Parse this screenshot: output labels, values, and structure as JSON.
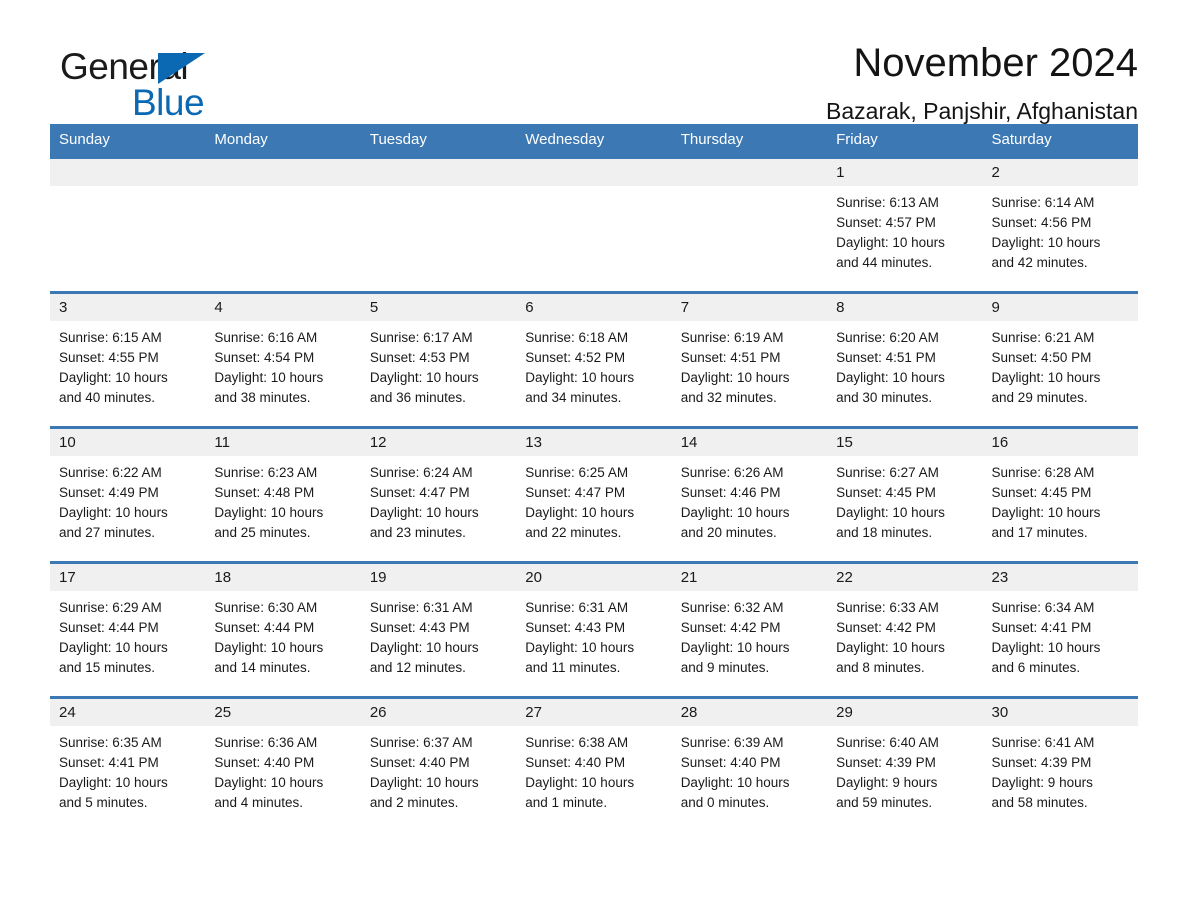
{
  "logo": {
    "word1": "General",
    "word2": "Blue",
    "triangle_color": "#0b69b4"
  },
  "header": {
    "title": "November 2024",
    "subtitle": "Bazarak, Panjshir, Afghanistan"
  },
  "theme": {
    "header_blue": "#3b78b4",
    "daynum_bg": "#f0f0f0",
    "text": "#1a1a1a"
  },
  "calendar": {
    "weekdays": [
      "Sunday",
      "Monday",
      "Tuesday",
      "Wednesday",
      "Thursday",
      "Friday",
      "Saturday"
    ],
    "weeks": [
      [
        {
          "day": "",
          "sunrise": "",
          "sunset": "",
          "daylight_line1": "",
          "daylight_line2": ""
        },
        {
          "day": "",
          "sunrise": "",
          "sunset": "",
          "daylight_line1": "",
          "daylight_line2": ""
        },
        {
          "day": "",
          "sunrise": "",
          "sunset": "",
          "daylight_line1": "",
          "daylight_line2": ""
        },
        {
          "day": "",
          "sunrise": "",
          "sunset": "",
          "daylight_line1": "",
          "daylight_line2": ""
        },
        {
          "day": "",
          "sunrise": "",
          "sunset": "",
          "daylight_line1": "",
          "daylight_line2": ""
        },
        {
          "day": "1",
          "sunrise": "Sunrise: 6:13 AM",
          "sunset": "Sunset: 4:57 PM",
          "daylight_line1": "Daylight: 10 hours",
          "daylight_line2": "and 44 minutes."
        },
        {
          "day": "2",
          "sunrise": "Sunrise: 6:14 AM",
          "sunset": "Sunset: 4:56 PM",
          "daylight_line1": "Daylight: 10 hours",
          "daylight_line2": "and 42 minutes."
        }
      ],
      [
        {
          "day": "3",
          "sunrise": "Sunrise: 6:15 AM",
          "sunset": "Sunset: 4:55 PM",
          "daylight_line1": "Daylight: 10 hours",
          "daylight_line2": "and 40 minutes."
        },
        {
          "day": "4",
          "sunrise": "Sunrise: 6:16 AM",
          "sunset": "Sunset: 4:54 PM",
          "daylight_line1": "Daylight: 10 hours",
          "daylight_line2": "and 38 minutes."
        },
        {
          "day": "5",
          "sunrise": "Sunrise: 6:17 AM",
          "sunset": "Sunset: 4:53 PM",
          "daylight_line1": "Daylight: 10 hours",
          "daylight_line2": "and 36 minutes."
        },
        {
          "day": "6",
          "sunrise": "Sunrise: 6:18 AM",
          "sunset": "Sunset: 4:52 PM",
          "daylight_line1": "Daylight: 10 hours",
          "daylight_line2": "and 34 minutes."
        },
        {
          "day": "7",
          "sunrise": "Sunrise: 6:19 AM",
          "sunset": "Sunset: 4:51 PM",
          "daylight_line1": "Daylight: 10 hours",
          "daylight_line2": "and 32 minutes."
        },
        {
          "day": "8",
          "sunrise": "Sunrise: 6:20 AM",
          "sunset": "Sunset: 4:51 PM",
          "daylight_line1": "Daylight: 10 hours",
          "daylight_line2": "and 30 minutes."
        },
        {
          "day": "9",
          "sunrise": "Sunrise: 6:21 AM",
          "sunset": "Sunset: 4:50 PM",
          "daylight_line1": "Daylight: 10 hours",
          "daylight_line2": "and 29 minutes."
        }
      ],
      [
        {
          "day": "10",
          "sunrise": "Sunrise: 6:22 AM",
          "sunset": "Sunset: 4:49 PM",
          "daylight_line1": "Daylight: 10 hours",
          "daylight_line2": "and 27 minutes."
        },
        {
          "day": "11",
          "sunrise": "Sunrise: 6:23 AM",
          "sunset": "Sunset: 4:48 PM",
          "daylight_line1": "Daylight: 10 hours",
          "daylight_line2": "and 25 minutes."
        },
        {
          "day": "12",
          "sunrise": "Sunrise: 6:24 AM",
          "sunset": "Sunset: 4:47 PM",
          "daylight_line1": "Daylight: 10 hours",
          "daylight_line2": "and 23 minutes."
        },
        {
          "day": "13",
          "sunrise": "Sunrise: 6:25 AM",
          "sunset": "Sunset: 4:47 PM",
          "daylight_line1": "Daylight: 10 hours",
          "daylight_line2": "and 22 minutes."
        },
        {
          "day": "14",
          "sunrise": "Sunrise: 6:26 AM",
          "sunset": "Sunset: 4:46 PM",
          "daylight_line1": "Daylight: 10 hours",
          "daylight_line2": "and 20 minutes."
        },
        {
          "day": "15",
          "sunrise": "Sunrise: 6:27 AM",
          "sunset": "Sunset: 4:45 PM",
          "daylight_line1": "Daylight: 10 hours",
          "daylight_line2": "and 18 minutes."
        },
        {
          "day": "16",
          "sunrise": "Sunrise: 6:28 AM",
          "sunset": "Sunset: 4:45 PM",
          "daylight_line1": "Daylight: 10 hours",
          "daylight_line2": "and 17 minutes."
        }
      ],
      [
        {
          "day": "17",
          "sunrise": "Sunrise: 6:29 AM",
          "sunset": "Sunset: 4:44 PM",
          "daylight_line1": "Daylight: 10 hours",
          "daylight_line2": "and 15 minutes."
        },
        {
          "day": "18",
          "sunrise": "Sunrise: 6:30 AM",
          "sunset": "Sunset: 4:44 PM",
          "daylight_line1": "Daylight: 10 hours",
          "daylight_line2": "and 14 minutes."
        },
        {
          "day": "19",
          "sunrise": "Sunrise: 6:31 AM",
          "sunset": "Sunset: 4:43 PM",
          "daylight_line1": "Daylight: 10 hours",
          "daylight_line2": "and 12 minutes."
        },
        {
          "day": "20",
          "sunrise": "Sunrise: 6:31 AM",
          "sunset": "Sunset: 4:43 PM",
          "daylight_line1": "Daylight: 10 hours",
          "daylight_line2": "and 11 minutes."
        },
        {
          "day": "21",
          "sunrise": "Sunrise: 6:32 AM",
          "sunset": "Sunset: 4:42 PM",
          "daylight_line1": "Daylight: 10 hours",
          "daylight_line2": "and 9 minutes."
        },
        {
          "day": "22",
          "sunrise": "Sunrise: 6:33 AM",
          "sunset": "Sunset: 4:42 PM",
          "daylight_line1": "Daylight: 10 hours",
          "daylight_line2": "and 8 minutes."
        },
        {
          "day": "23",
          "sunrise": "Sunrise: 6:34 AM",
          "sunset": "Sunset: 4:41 PM",
          "daylight_line1": "Daylight: 10 hours",
          "daylight_line2": "and 6 minutes."
        }
      ],
      [
        {
          "day": "24",
          "sunrise": "Sunrise: 6:35 AM",
          "sunset": "Sunset: 4:41 PM",
          "daylight_line1": "Daylight: 10 hours",
          "daylight_line2": "and 5 minutes."
        },
        {
          "day": "25",
          "sunrise": "Sunrise: 6:36 AM",
          "sunset": "Sunset: 4:40 PM",
          "daylight_line1": "Daylight: 10 hours",
          "daylight_line2": "and 4 minutes."
        },
        {
          "day": "26",
          "sunrise": "Sunrise: 6:37 AM",
          "sunset": "Sunset: 4:40 PM",
          "daylight_line1": "Daylight: 10 hours",
          "daylight_line2": "and 2 minutes."
        },
        {
          "day": "27",
          "sunrise": "Sunrise: 6:38 AM",
          "sunset": "Sunset: 4:40 PM",
          "daylight_line1": "Daylight: 10 hours",
          "daylight_line2": "and 1 minute."
        },
        {
          "day": "28",
          "sunrise": "Sunrise: 6:39 AM",
          "sunset": "Sunset: 4:40 PM",
          "daylight_line1": "Daylight: 10 hours",
          "daylight_line2": "and 0 minutes."
        },
        {
          "day": "29",
          "sunrise": "Sunrise: 6:40 AM",
          "sunset": "Sunset: 4:39 PM",
          "daylight_line1": "Daylight: 9 hours",
          "daylight_line2": "and 59 minutes."
        },
        {
          "day": "30",
          "sunrise": "Sunrise: 6:41 AM",
          "sunset": "Sunset: 4:39 PM",
          "daylight_line1": "Daylight: 9 hours",
          "daylight_line2": "and 58 minutes."
        }
      ]
    ]
  }
}
